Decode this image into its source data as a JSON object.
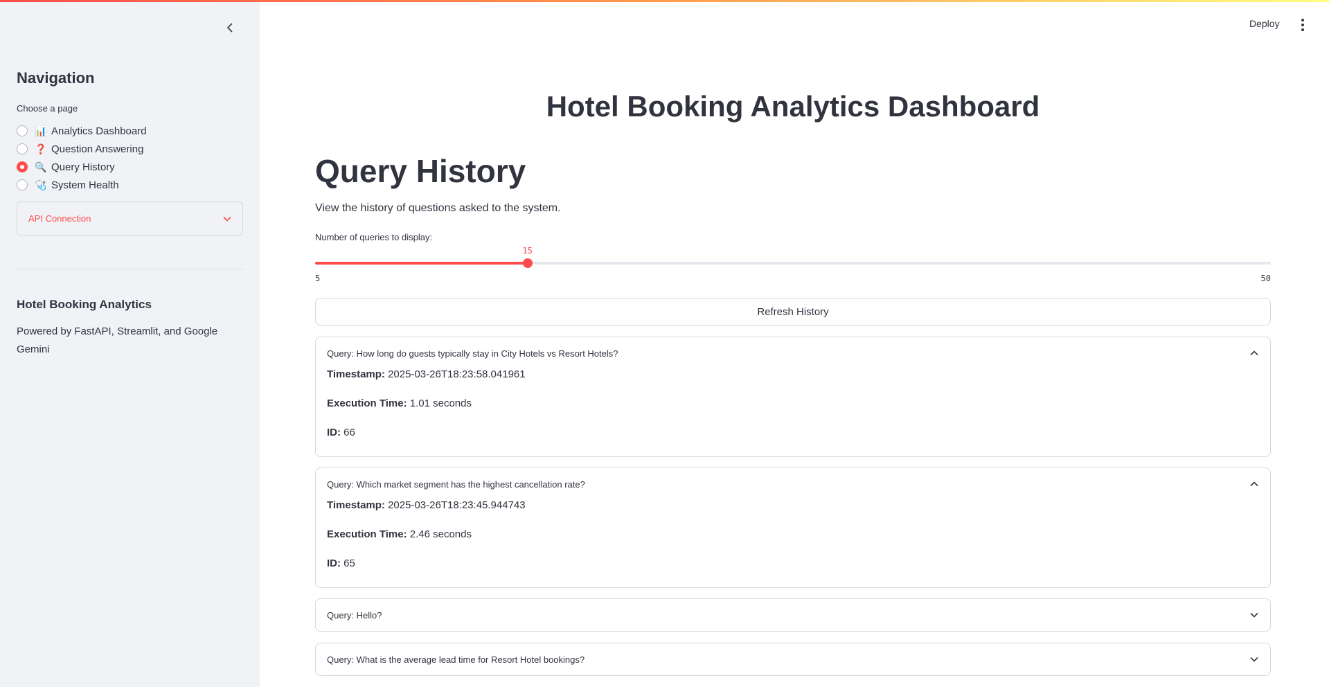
{
  "sidebar": {
    "title": "Navigation",
    "choose_label": "Choose a page",
    "pages": [
      {
        "emoji": "📊",
        "label": "Analytics Dashboard",
        "selected": false
      },
      {
        "emoji": "❓",
        "label": "Question Answering",
        "selected": false
      },
      {
        "emoji": "🔍",
        "label": "Query History",
        "selected": true
      },
      {
        "emoji": "🩺",
        "label": "System Health",
        "selected": false
      }
    ],
    "api_connection_label": "API Connection",
    "footer_title": "Hotel Booking Analytics",
    "footer_text": "Powered by FastAPI, Streamlit, and Google Gemini"
  },
  "header": {
    "deploy_label": "Deploy"
  },
  "main": {
    "dashboard_title": "Hotel Booking Analytics Dashboard",
    "page_title": "Query History",
    "description": "View the history of questions asked to the system.",
    "slider": {
      "label": "Number of queries to display:",
      "value": 15,
      "value_text": "15",
      "min": 5,
      "min_text": "5",
      "max": 50,
      "max_text": "50"
    },
    "refresh_label": "Refresh History",
    "field_labels": {
      "timestamp": "Timestamp:",
      "execution_time": "Execution Time:",
      "id": "ID:"
    },
    "queries": [
      {
        "title": "Query: How long do guests typically stay in City Hotels vs Resort Hotels?",
        "expanded": true,
        "timestamp": "2025-03-26T18:23:58.041961",
        "execution_time": "1.01 seconds",
        "id": "66"
      },
      {
        "title": "Query: Which market segment has the highest cancellation rate?",
        "expanded": true,
        "timestamp": "2025-03-26T18:23:45.944743",
        "execution_time": "2.46 seconds",
        "id": "65"
      },
      {
        "title": "Query: Hello?",
        "expanded": false
      },
      {
        "title": "Query: What is the average lead time for Resort Hotel bookings?",
        "expanded": false
      }
    ]
  },
  "colors": {
    "accent": "#ff4b4b",
    "sidebar_bg": "#f0f2f6",
    "text": "#31333f",
    "border": "#d6d8de"
  }
}
